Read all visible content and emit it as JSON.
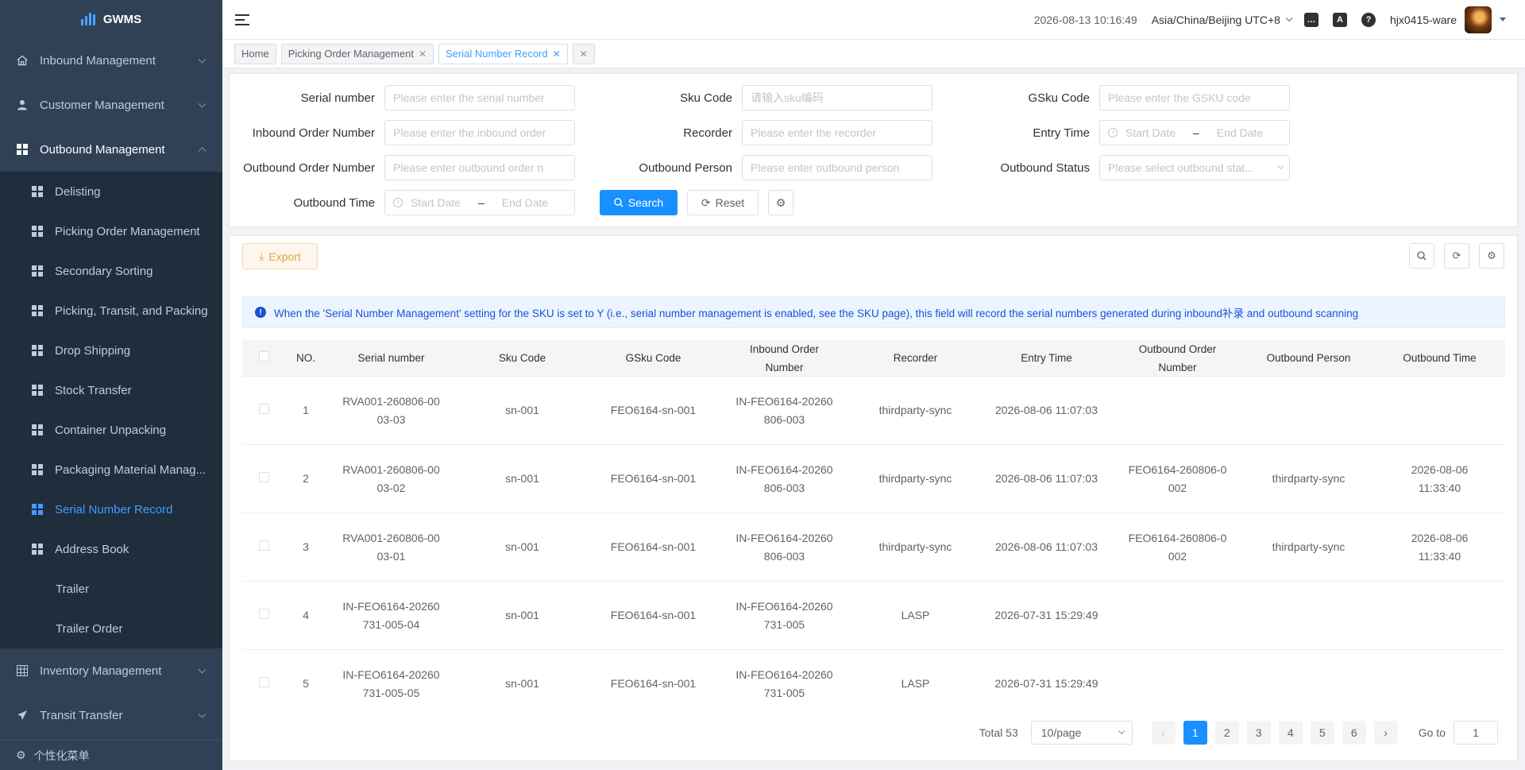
{
  "app": {
    "title": "GWMS"
  },
  "sidebar": {
    "groups": [
      {
        "label": "Inbound Management",
        "icon": "home-icon"
      },
      {
        "label": "Customer Management",
        "icon": "user-icon"
      },
      {
        "label": "Outbound Management",
        "icon": "grid-icon"
      }
    ],
    "outbound_items": [
      {
        "label": "Delisting"
      },
      {
        "label": "Picking Order Management"
      },
      {
        "label": "Secondary Sorting"
      },
      {
        "label": "Picking, Transit, and Packing"
      },
      {
        "label": "Drop Shipping"
      },
      {
        "label": "Stock Transfer"
      },
      {
        "label": "Container Unpacking"
      },
      {
        "label": "Packaging Material Manag..."
      },
      {
        "label": "Serial Number Record"
      },
      {
        "label": "Address Book"
      },
      {
        "label": "Trailer"
      },
      {
        "label": "Trailer Order"
      }
    ],
    "groups_after": [
      {
        "label": "Inventory Management",
        "icon": "table-icon"
      },
      {
        "label": "Transit Transfer",
        "icon": "send-icon"
      }
    ],
    "bottom_label": "个性化菜单"
  },
  "header": {
    "datetime": "2026-08-13 10:16:49",
    "timezone": "Asia/China/Beijing UTC+8",
    "username": "hjx0415-ware"
  },
  "tags": {
    "home": "Home",
    "picking": "Picking Order Management",
    "serial": "Serial Number Record"
  },
  "search": {
    "serial_label": "Serial number",
    "serial_ph": "Please enter the serial number",
    "sku_label": "Sku Code",
    "sku_ph": "请输入sku编码",
    "gsku_label": "GSku Code",
    "gsku_ph": "Please enter the GSKU code",
    "inbound_label": "Inbound Order Number",
    "inbound_ph": "Please enter the inbound order",
    "recorder_label": "Recorder",
    "recorder_ph": "Please enter the recorder",
    "entry_label": "Entry Time",
    "outbound_label": "Outbound Order Number",
    "outbound_ph": "Please enter outbound order n",
    "person_label": "Outbound Person",
    "person_ph": "Please enter outbound person",
    "status_label": "Outbound Status",
    "status_ph": "Please select outbound stat...",
    "otime_label": "Outbound Time",
    "start_date": "Start Date",
    "end_date": "End Date",
    "search_btn": "Search",
    "reset_btn": "Reset"
  },
  "toolbar": {
    "export_label": "Export"
  },
  "alert": {
    "text": "When the 'Serial Number Management' setting for the SKU is set to Y (i.e., serial number management is enabled, see the SKU page), this field will record the serial numbers generated during inbound补录 and outbound scanning"
  },
  "table": {
    "headers": {
      "no": "NO.",
      "serial": "Serial number",
      "sku": "Sku Code",
      "gsku": "GSku Code",
      "inbound": "Inbound Order Number",
      "recorder": "Recorder",
      "entry": "Entry Time",
      "outbound": "Outbound Order Number",
      "person": "Outbound Person",
      "otime": "Outbound Time"
    },
    "rows": [
      {
        "no": "1",
        "serial": "RVA001-260806-0003-03",
        "sku": "sn-001",
        "gsku": "FEO6164-sn-001",
        "inbound": "IN-FEO6164-20260806-003",
        "recorder": "thirdparty-sync",
        "entry": "2026-08-06 11:07:03",
        "outbound": "",
        "person": "",
        "otime": ""
      },
      {
        "no": "2",
        "serial": "RVA001-260806-0003-02",
        "sku": "sn-001",
        "gsku": "FEO6164-sn-001",
        "inbound": "IN-FEO6164-20260806-003",
        "recorder": "thirdparty-sync",
        "entry": "2026-08-06 11:07:03",
        "outbound": "FEO6164-260806-0002",
        "person": "thirdparty-sync",
        "otime": "2026-08-06 11:33:40"
      },
      {
        "no": "3",
        "serial": "RVA001-260806-0003-01",
        "sku": "sn-001",
        "gsku": "FEO6164-sn-001",
        "inbound": "IN-FEO6164-20260806-003",
        "recorder": "thirdparty-sync",
        "entry": "2026-08-06 11:07:03",
        "outbound": "FEO6164-260806-0002",
        "person": "thirdparty-sync",
        "otime": "2026-08-06 11:33:40"
      },
      {
        "no": "4",
        "serial": "IN-FEO6164-20260731-005-04",
        "sku": "sn-001",
        "gsku": "FEO6164-sn-001",
        "inbound": "IN-FEO6164-20260731-005",
        "recorder": "LASP",
        "entry": "2026-07-31 15:29:49",
        "outbound": "",
        "person": "",
        "otime": ""
      },
      {
        "no": "5",
        "serial": "IN-FEO6164-20260731-005-05",
        "sku": "sn-001",
        "gsku": "FEO6164-sn-001",
        "inbound": "IN-FEO6164-20260731-005",
        "recorder": "LASP",
        "entry": "2026-07-31 15:29:49",
        "outbound": "",
        "person": "",
        "otime": ""
      }
    ]
  },
  "pagination": {
    "total_label": "Total 53",
    "page_size": "10/page",
    "pages": [
      "1",
      "2",
      "3",
      "4",
      "5",
      "6"
    ],
    "current": "1",
    "goto_label": "Go to",
    "goto_value": "1"
  },
  "colors": {
    "primary": "#1890ff",
    "sidebar_bg": "#304156",
    "submenu_bg": "#1f2d3d",
    "active": "#409eff",
    "warning": "#e6a23c"
  }
}
